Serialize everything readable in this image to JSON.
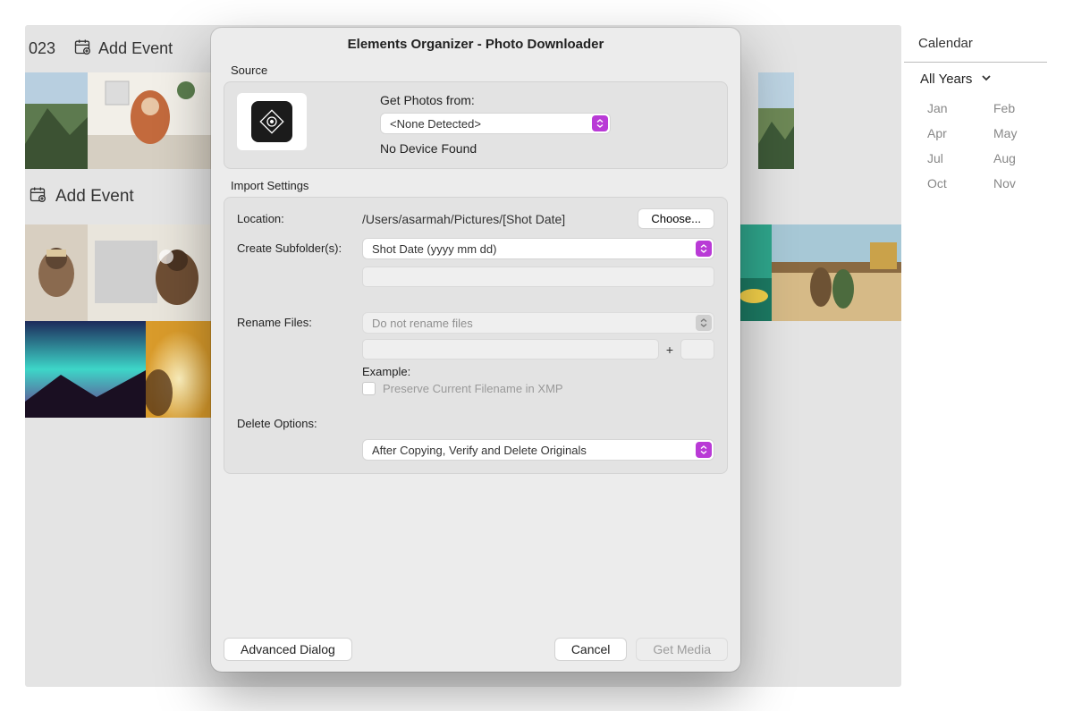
{
  "background": {
    "year_fragment": "023",
    "add_event": "Add Event"
  },
  "calendar": {
    "title": "Calendar",
    "years_label": "All Years",
    "months": [
      "Jan",
      "Feb",
      "Apr",
      "May",
      "Jul",
      "Aug",
      "Oct",
      "Nov"
    ]
  },
  "dialog": {
    "title": "Elements Organizer - Photo Downloader",
    "source_section": "Source",
    "get_photos_label": "Get Photos from:",
    "get_photos_value": "<None Detected>",
    "no_device": "No Device Found",
    "import_section": "Import Settings",
    "location_label": "Location:",
    "location_value": "/Users/asarmah/Pictures/[Shot Date]",
    "choose_button": "Choose...",
    "subfolder_label": "Create Subfolder(s):",
    "subfolder_value": "Shot Date (yyyy mm dd)",
    "rename_label": "Rename Files:",
    "rename_value": "Do not rename files",
    "plus": "+",
    "example_label": "Example:",
    "xmp_label": "Preserve Current Filename in XMP",
    "delete_label": "Delete Options:",
    "delete_value": "After Copying, Verify and Delete Originals",
    "advanced_button": "Advanced Dialog",
    "cancel_button": "Cancel",
    "get_media_button": "Get Media"
  }
}
